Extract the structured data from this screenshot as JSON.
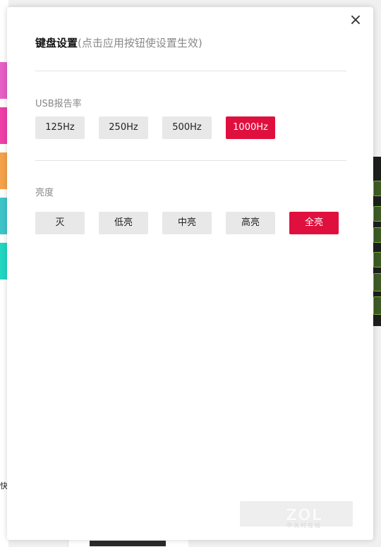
{
  "background": {
    "strip_colors": [
      "#e660c6",
      "#ef3fa8",
      "#f4a24a",
      "#3fc5c9",
      "#22d6c2"
    ],
    "side_text": "快"
  },
  "dialog": {
    "close_glyph": "×",
    "title": "键盘设置",
    "subtitle": "(点击应用按钮使设置生效)",
    "usb_rate": {
      "label": "USB报告率",
      "options": [
        "125Hz",
        "250Hz",
        "500Hz",
        "1000Hz"
      ],
      "selected": "1000Hz"
    },
    "brightness": {
      "label": "亮度",
      "options": [
        "灭",
        "低亮",
        "中亮",
        "高亮",
        "全亮"
      ],
      "selected": "全亮"
    },
    "accent_color": "#e0103e"
  },
  "watermark": {
    "main": "ZOL",
    "sub": "中关村在线"
  }
}
